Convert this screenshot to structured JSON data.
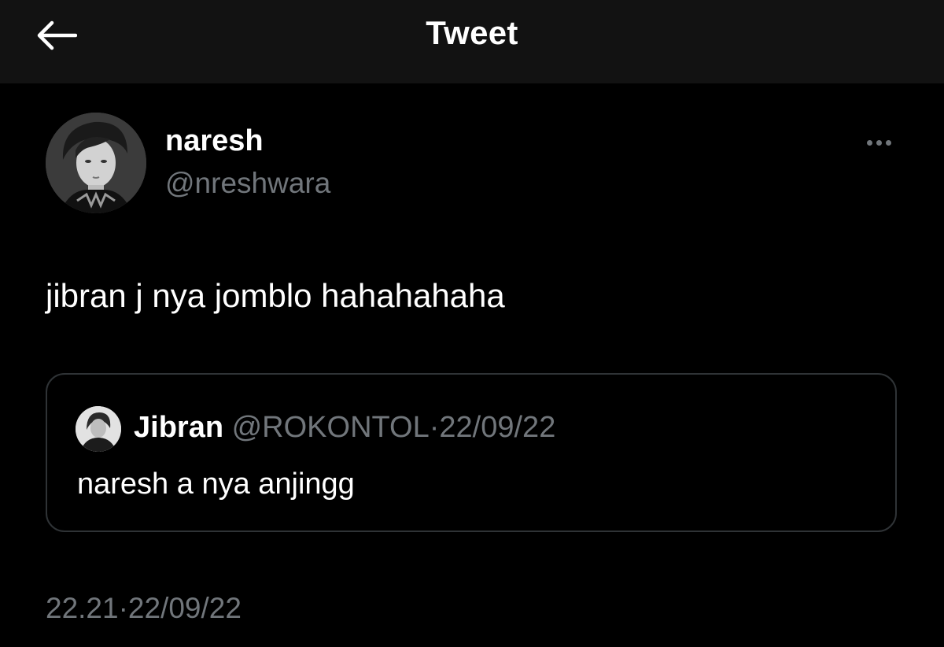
{
  "header": {
    "title": "Tweet",
    "back_icon": "arrow-left-icon"
  },
  "tweet": {
    "author": {
      "name": "naresh",
      "handle": "@nreshwara"
    },
    "more_icon": "more-horizontal-icon",
    "text": "jibran j nya jomblo hahahahaha",
    "quote": {
      "name": "Jibran",
      "handle": "@ROKONTOL",
      "separator": "·",
      "date": "22/09/22",
      "text": "naresh a nya anjingg"
    },
    "timestamp": {
      "time": "22.21",
      "separator": "·",
      "date": "22/09/22"
    }
  },
  "colors": {
    "background": "#000000",
    "header_background": "#121212",
    "primary_text": "#ffffff",
    "secondary_text": "#71767b",
    "border": "#2f3336"
  }
}
